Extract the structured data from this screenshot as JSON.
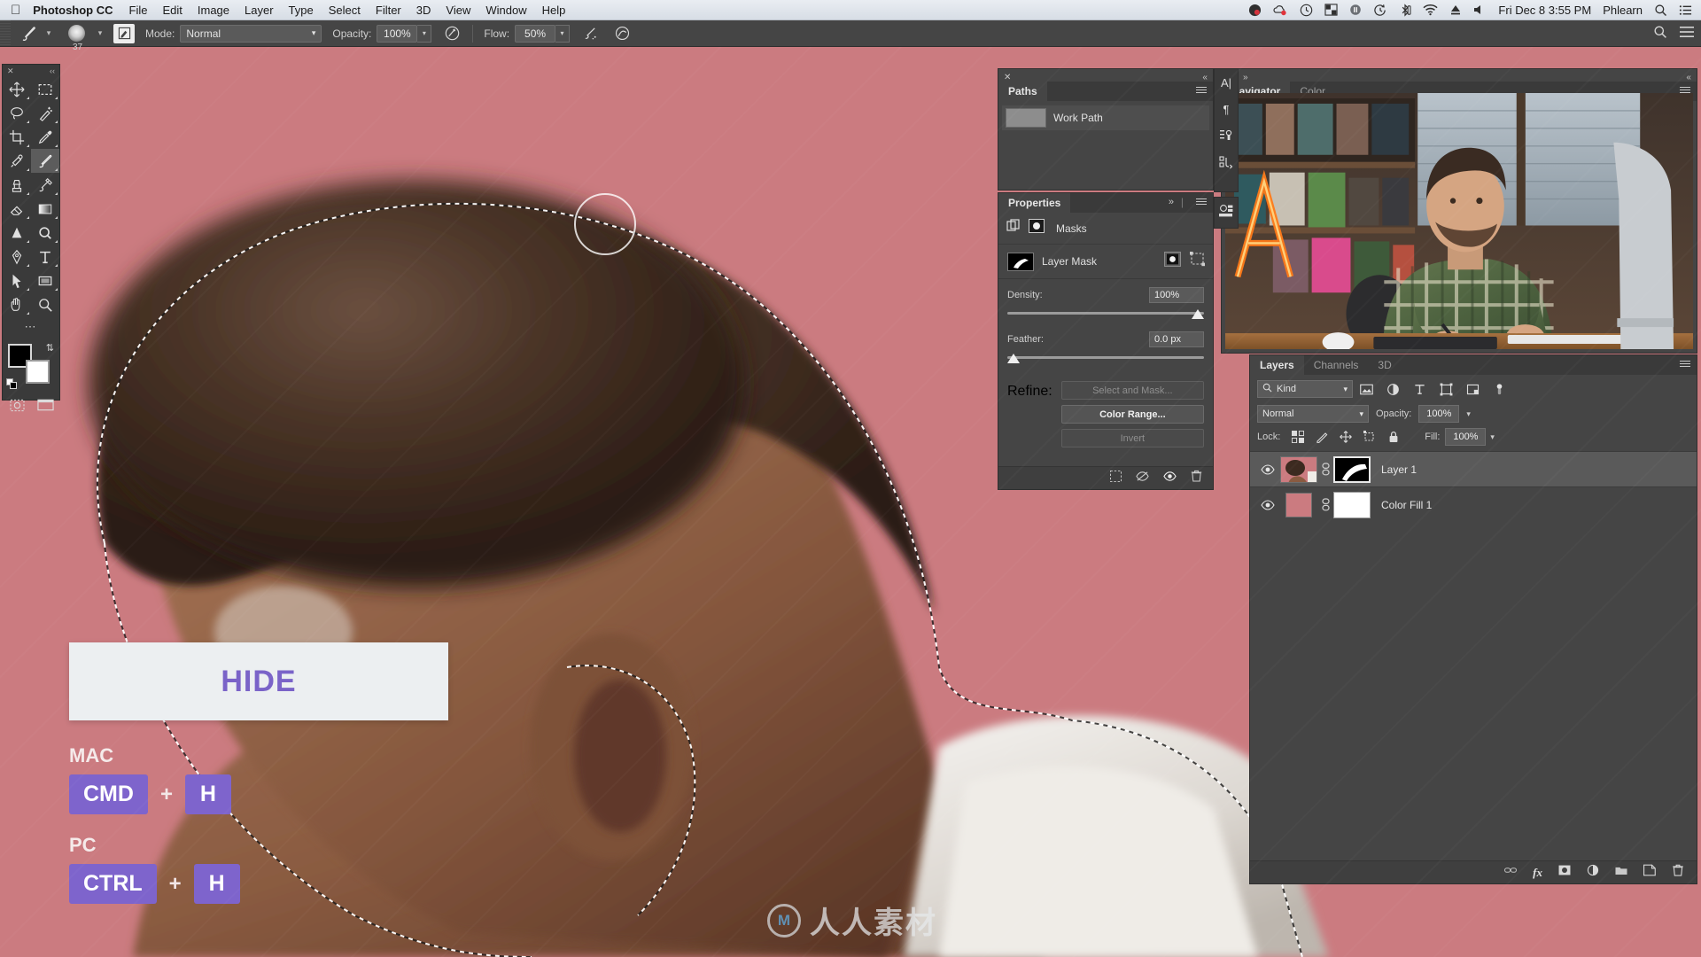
{
  "macbar": {
    "apple_icon": "apple-logo-icon",
    "app_name": "Photoshop CC",
    "menus": [
      "File",
      "Edit",
      "Image",
      "Layer",
      "Type",
      "Select",
      "Filter",
      "3D",
      "View",
      "Window",
      "Help"
    ],
    "status_icons": [
      "dropbox-icon",
      "cloud-sync-icon",
      "clock-icon",
      "window-manager-icon",
      "battery-icon",
      "time-machine-icon",
      "bluetooth-icon",
      "wifi-icon",
      "eject-icon",
      "volume-icon"
    ],
    "datetime": "Fri Dec 8  3:55 PM",
    "user": "Phlearn",
    "search_icon": "search-icon",
    "notification_icon": "notification-center-icon"
  },
  "options_bar": {
    "tool_icon": "brush-tool-icon",
    "brush_size": "37",
    "tablet_pressure_icon": "tablet-pressure-icon",
    "mode_label": "Mode:",
    "mode_value": "Normal",
    "opacity_label": "Opacity:",
    "opacity_value": "100%",
    "opacity_pressure_icon": "pressure-opacity-icon",
    "flow_label": "Flow:",
    "flow_value": "50%",
    "airbrush_icon": "airbrush-icon",
    "smoothing_icon": "smoothing-icon",
    "search_icon": "search-icon",
    "workspace_icon": "workspace-icon"
  },
  "tools": {
    "close_icon": "close-icon",
    "collapse_icon": "collapse-icon",
    "items": [
      {
        "name": "move-tool",
        "label": "Move Tool",
        "icon": "move-icon",
        "active": false
      },
      {
        "name": "marquee-tool",
        "label": "Rectangular Marquee Tool",
        "icon": "marquee-icon",
        "active": false
      },
      {
        "name": "lasso-tool",
        "label": "Lasso Tool",
        "icon": "lasso-icon",
        "active": false
      },
      {
        "name": "quick-selection-tool",
        "label": "Quick Selection Tool",
        "icon": "magic-wand-icon",
        "active": false
      },
      {
        "name": "crop-tool",
        "label": "Crop Tool",
        "icon": "crop-icon",
        "active": false
      },
      {
        "name": "eyedropper-tool",
        "label": "Eyedropper Tool",
        "icon": "eyedropper-icon",
        "active": false
      },
      {
        "name": "healing-brush-tool",
        "label": "Spot Healing Brush Tool",
        "icon": "healing-icon",
        "active": false
      },
      {
        "name": "brush-tool",
        "label": "Brush Tool",
        "icon": "brush-icon",
        "active": true
      },
      {
        "name": "clone-stamp-tool",
        "label": "Clone Stamp Tool",
        "icon": "stamp-icon",
        "active": false
      },
      {
        "name": "history-brush-tool",
        "label": "History Brush Tool",
        "icon": "history-brush-icon",
        "active": false
      },
      {
        "name": "eraser-tool",
        "label": "Eraser Tool",
        "icon": "eraser-icon",
        "active": false
      },
      {
        "name": "gradient-tool",
        "label": "Gradient Tool",
        "icon": "gradient-icon",
        "active": false
      },
      {
        "name": "blur-tool",
        "label": "Blur Tool",
        "icon": "blur-icon",
        "active": false
      },
      {
        "name": "dodge-tool",
        "label": "Dodge Tool",
        "icon": "dodge-icon",
        "active": false
      },
      {
        "name": "pen-tool",
        "label": "Pen Tool",
        "icon": "pen-icon",
        "active": false
      },
      {
        "name": "type-tool",
        "label": "Horizontal Type Tool",
        "icon": "type-icon",
        "active": false
      },
      {
        "name": "path-selection-tool",
        "label": "Path Selection Tool",
        "icon": "path-arrow-icon",
        "active": false
      },
      {
        "name": "rectangle-tool",
        "label": "Rectangle Tool",
        "icon": "rectangle-icon",
        "active": false
      },
      {
        "name": "hand-tool",
        "label": "Hand Tool",
        "icon": "hand-icon",
        "active": false
      },
      {
        "name": "zoom-tool",
        "label": "Zoom Tool",
        "icon": "zoom-icon",
        "active": false
      }
    ],
    "more_icon": "edit-toolbar-icon",
    "foreground_color": "#000000",
    "background_color": "#ffffff",
    "swap_icon": "swap-colors-icon",
    "default_icon": "default-colors-icon",
    "quickmask_icon": "quick-mask-icon",
    "screenmode_icon": "screen-mode-icon"
  },
  "paths_panel": {
    "close_icon": "close-icon",
    "collapse_icon": "collapse-icon",
    "menu_icon": "panel-menu-icon",
    "tabs": [
      {
        "label": "Paths",
        "active": true
      }
    ],
    "rows": [
      {
        "name": "Work Path"
      }
    ]
  },
  "properties_panel": {
    "tabs": [
      {
        "label": "Properties",
        "active": true
      }
    ],
    "expand_icon": "expand-icon",
    "menu_icon": "panel-menu-icon",
    "header_icons": [
      "masks-properties-icon",
      "pixel-mask-icon"
    ],
    "header_title": "Masks",
    "mask_thumb_label": "Layer Mask",
    "mask_thumb_icon": "layer-mask-thumbnail",
    "mask_select_icon": "pixel-mask-icon",
    "mask_vector_icon": "vector-mask-icon",
    "density_label": "Density:",
    "density_value": "100%",
    "density_slider_pct": 100,
    "feather_label": "Feather:",
    "feather_value": "0.0 px",
    "feather_slider_pct": 0,
    "refine_label": "Refine:",
    "select_and_mask_button": "Select and Mask...",
    "color_range_button": "Color Range...",
    "invert_button": "Invert",
    "footer_icons": [
      "load-selection-icon",
      "apply-mask-icon",
      "toggle-mask-icon",
      "delete-mask-icon"
    ]
  },
  "navigator_panel": {
    "close_icon": "close-icon",
    "expand_icon": "expand-icon",
    "collapse_icon": "collapse-icon",
    "menu_icon": "panel-menu-icon",
    "tabs": [
      {
        "label": "Navigator",
        "active": true
      },
      {
        "label": "Color",
        "active": false
      }
    ],
    "preview_description": "Instructor seated at desk with drawing tablet, neon A sign and framed photos behind"
  },
  "icon_rail": {
    "icons": [
      "character-panel-icon",
      "paragraph-panel-icon",
      "styles-panel-icon",
      "actions-panel-icon",
      "adjustments-panel-icon"
    ]
  },
  "layers_panel": {
    "tabs": [
      {
        "label": "Layers",
        "active": true
      },
      {
        "label": "Channels",
        "active": false
      },
      {
        "label": "3D",
        "active": false
      }
    ],
    "menu_icon": "panel-menu-icon",
    "filter_kind_label": "Kind",
    "filter_search_icon": "search-icon",
    "filter_icons": [
      "filter-pixel-icon",
      "filter-adjustment-icon",
      "filter-type-icon",
      "filter-shape-icon",
      "filter-smartobject-icon",
      "filter-toggle-icon"
    ],
    "blend_mode": "Normal",
    "opacity_label": "Opacity:",
    "opacity_value": "100%",
    "lock_label": "Lock:",
    "lock_icons": [
      "lock-transparent-icon",
      "lock-image-icon",
      "lock-position-icon",
      "lock-artboard-icon",
      "lock-all-icon"
    ],
    "fill_label": "Fill:",
    "fill_value": "100%",
    "layers": [
      {
        "name": "Layer 1",
        "visible": true,
        "selected": true,
        "has_mask": true,
        "thumb": "photo",
        "mask_icon": "layer-mask-thumbnail",
        "eye_icon": "eye-icon",
        "link_icon": "link-icon"
      },
      {
        "name": "Color Fill 1",
        "visible": true,
        "selected": false,
        "has_mask": true,
        "thumb": "#cb7b80",
        "mask_icon": "white-mask-thumbnail",
        "eye_icon": "eye-icon",
        "link_icon": "link-icon"
      }
    ],
    "footer_icons": [
      "link-layers-icon",
      "layer-style-fx-icon",
      "add-layer-mask-icon",
      "new-adjustment-layer-icon",
      "new-group-icon",
      "new-layer-icon",
      "delete-layer-icon"
    ]
  },
  "overlay": {
    "banner_text": "HIDE",
    "banner_color": "#7a63c8",
    "shortcuts": [
      {
        "os": "MAC",
        "keys": [
          "CMD",
          "H"
        ],
        "separator": "+"
      },
      {
        "os": "PC",
        "keys": [
          "CTRL",
          "H"
        ],
        "separator": "+"
      }
    ]
  },
  "watermark": {
    "logo_text": "人人素材",
    "mark_letter": "M"
  },
  "canvas": {
    "background_color": "#cb7b80",
    "description": "Close-up portrait of man with curly hair, active selection marching ants around subject"
  }
}
